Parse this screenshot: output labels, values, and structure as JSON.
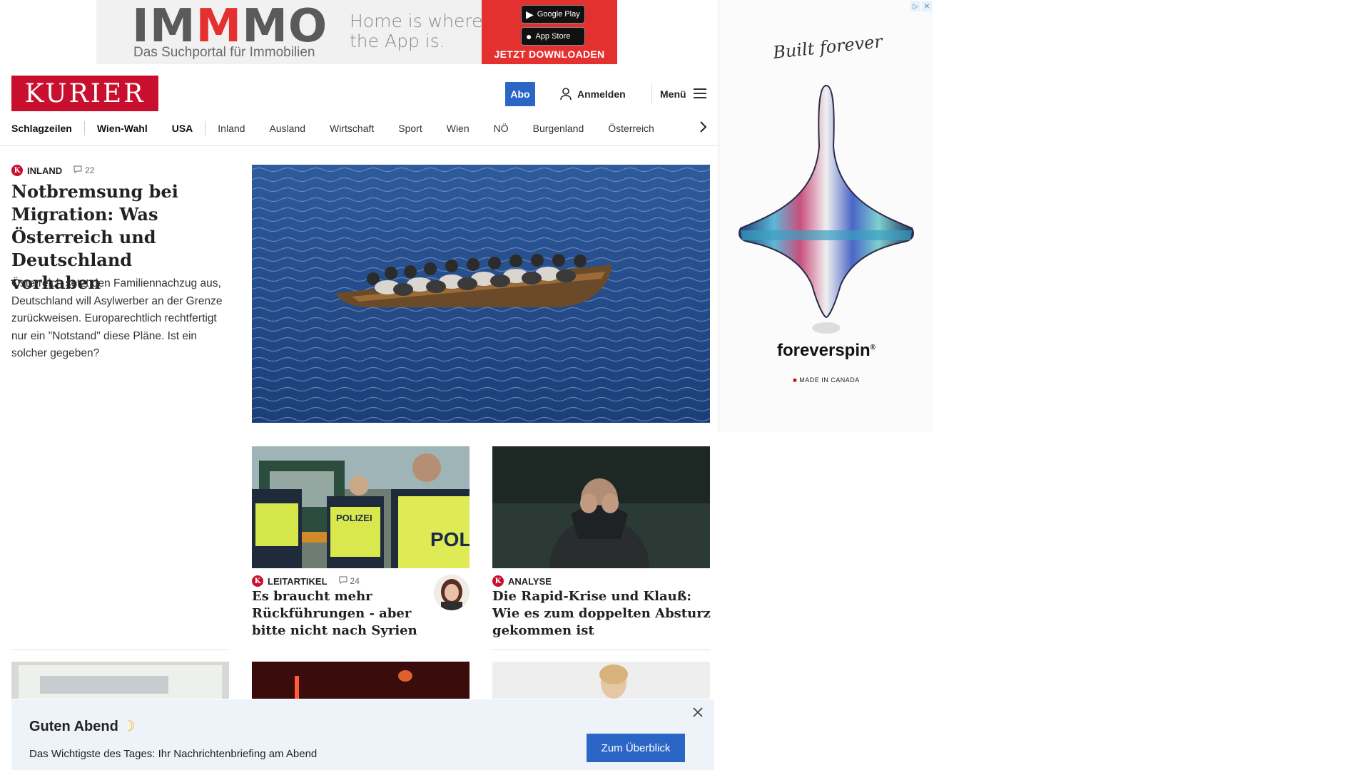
{
  "top_ad": {
    "logo_part1": "IM",
    "logo_part2": "M",
    "logo_part3": "MO",
    "logo_sub": "Das Suchportal für Immobilien",
    "tagline": "Home is where the App is.",
    "google_play": "Google Play",
    "app_store": "App Store",
    "cta": "JETZT DOWNLOADEN"
  },
  "header": {
    "logo": "KURIER",
    "abo": "Abo",
    "login": "Anmelden",
    "menu": "Menü"
  },
  "nav": {
    "items": [
      "Schlagzeilen",
      "Wien-Wahl",
      "USA",
      "Inland",
      "Ausland",
      "Wirtschaft",
      "Sport",
      "Wien",
      "NÖ",
      "Burgenland",
      "Österreich"
    ]
  },
  "side_ad": {
    "script": "Built forever",
    "brand": "foreverspin",
    "made": "MADE IN CANADA"
  },
  "lead": {
    "kicker": "INLAND",
    "comments": "22",
    "title": "Notbremsung bei Migration: Was Österreich und Deutschland vorhaben",
    "text": "Österreich setzt den Familiennachzug aus, Deutschland will Asylwerber an der Grenze zurückweisen. Europarechtlich rechtfertigt nur ein \"Notstand\" diese Pläne. Ist ein solcher gegeben?"
  },
  "cards": [
    {
      "kicker": "LEITARTIKEL",
      "comments": "24",
      "title": "Es braucht mehr Rückführungen - aber bitte nicht nach Syrien",
      "police_text_1": "POLIZEI",
      "police_text_2": "POLI"
    },
    {
      "kicker": "ANALYSE",
      "title": "Die Rapid-Krise und Klauß: Wie es zum doppelten Absturz gekommen ist"
    }
  ],
  "evening": {
    "title": "Guten Abend",
    "text": "Das Wichtigste des Tages: Ihr Nachrichtenbriefing am Abend",
    "button": "Zum Überblick"
  },
  "colors": {
    "brand_red": "#c8102e",
    "accent_blue": "#2b66c7",
    "banner_bg": "#eef3fa"
  }
}
